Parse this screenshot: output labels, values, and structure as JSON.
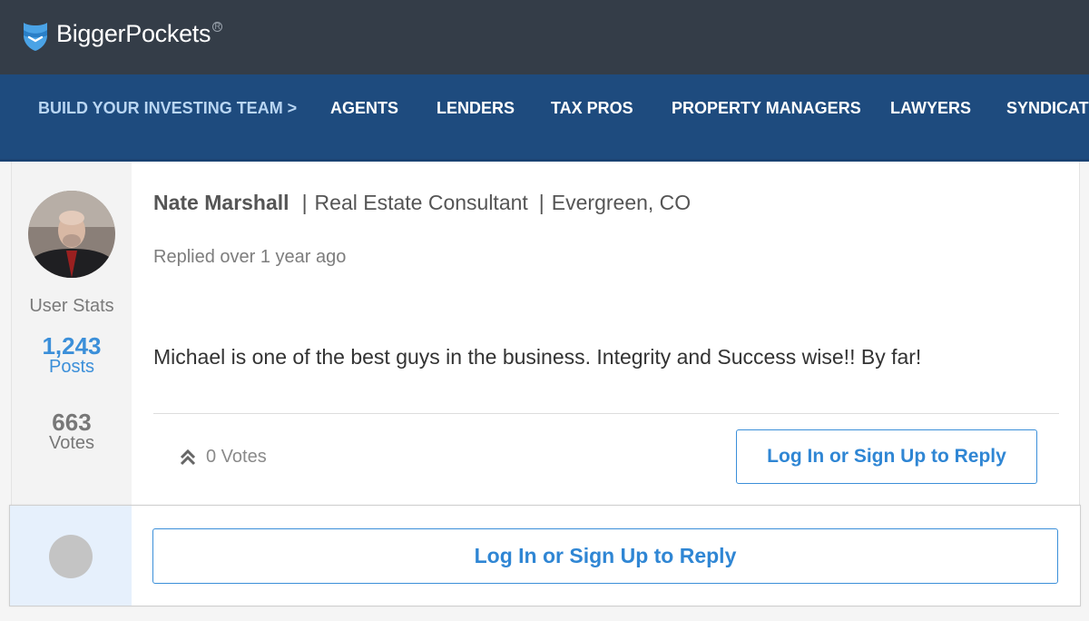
{
  "header": {
    "logo_text": "BiggerPockets",
    "logo_reg": "R"
  },
  "nav": {
    "items": [
      "BUILD YOUR INVESTING TEAM >",
      "AGENTS",
      "LENDERS",
      "TAX PROS",
      "PROPERTY MANAGERS",
      "LAWYERS",
      "SYNDICATE"
    ]
  },
  "post": {
    "author": "Nate Marshall",
    "title": "Real Estate Consultant",
    "location": "Evergreen, CO",
    "replied": "Replied over 1 year ago",
    "body": "Michael is one of the best guys in the business. Integrity and Success wise!! By far!",
    "votes_label": "0 Votes",
    "reply_button": "Log In or Sign Up to Reply"
  },
  "user_stats": {
    "title": "User Stats",
    "posts_count": "1,243",
    "posts_label": "Posts",
    "votes_count": "663",
    "votes_label": "Votes"
  },
  "reply_box": {
    "button": "Log In or Sign Up to Reply"
  },
  "colors": {
    "topbar": "#343d48",
    "navbar": "#1e4b7e",
    "accent_blue": "#3b8fd9"
  }
}
